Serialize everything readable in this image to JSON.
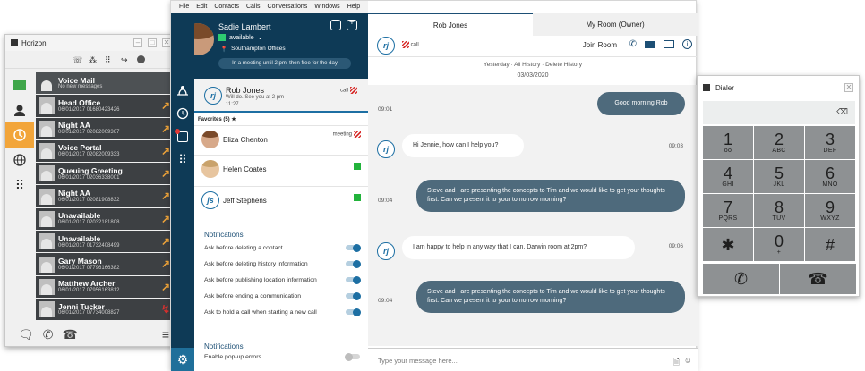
{
  "horizon": {
    "title": "Horizon",
    "entries": [
      {
        "name": "Voice Mail",
        "sub": "No new messages",
        "type": "voicemail"
      },
      {
        "name": "Head Office",
        "sub": "06/01/2017  01680423426",
        "type": "out"
      },
      {
        "name": "Night AA",
        "sub": "06/01/2017  02082009367",
        "type": "out"
      },
      {
        "name": "Voice Portal",
        "sub": "06/01/2017  02082009333",
        "type": "out"
      },
      {
        "name": "Queuing Greeting",
        "sub": "06/01/2017  02036338001",
        "type": "out"
      },
      {
        "name": "Night AA",
        "sub": "06/01/2017  02081908832",
        "type": "out"
      },
      {
        "name": "Unavailable",
        "sub": "06/01/2017  02032181808",
        "type": "out"
      },
      {
        "name": "Unavailable",
        "sub": "06/01/2017  01732408499",
        "type": "out"
      },
      {
        "name": "Gary Mason",
        "sub": "06/01/2017  07796166382",
        "type": "out"
      },
      {
        "name": "Matthew Archer",
        "sub": "06/01/2017  07956163812",
        "type": "out"
      },
      {
        "name": "Jenni Tucker",
        "sub": "06/01/2017  07734008827",
        "type": "missed"
      }
    ]
  },
  "menu": [
    "File",
    "Edit",
    "Contacts",
    "Calls",
    "Conversations",
    "Windows",
    "Help"
  ],
  "profile": {
    "name": "Sadie Lambert",
    "status": "available",
    "location": "Southampton Offices",
    "note": "In a meeting until 2 pm, then free for the day"
  },
  "active_conversation": {
    "initials": "rj",
    "name": "Rob Jones",
    "preview_line1": "Will do. See you at 2 pm",
    "preview_line2": "11:27",
    "tag": "call"
  },
  "favorites_label": "Favorites (5) ★",
  "favorites": [
    {
      "name": "Eliza Chenton",
      "tag": "meeting"
    },
    {
      "name": "Helen Coates",
      "tag": ""
    },
    {
      "name": "Jeff Stephens",
      "tag": "",
      "initials": "js"
    }
  ],
  "notifications": {
    "heading": "Notifications",
    "items": [
      "Ask before deleting a contact",
      "Ask before deleting history information",
      "Ask before publishing location information",
      "Ask before ending a communication",
      "Ask to hold a call when starting a new call"
    ],
    "heading2": "Notifications",
    "popup": "Enable pop-up errors"
  },
  "tabs": [
    "Rob Jones",
    "My Room (Owner)"
  ],
  "chat_header": {
    "initials": "rj",
    "tag": "call",
    "join": "Join Room"
  },
  "history_bar": "Yesterday  ·  All History  ·  Delete History",
  "date": "03/03/2020",
  "messages": [
    {
      "side": "out",
      "time": "09:01",
      "text": "Good morning Rob"
    },
    {
      "side": "in",
      "time": "09:03",
      "text": "Hi Jennie, how can I help you?"
    },
    {
      "side": "out",
      "time": "09:04",
      "text": "Steve and I are presenting the concepts to Tim and we would like to get your thoughts first. Can we present it to your tomorrow morning?"
    },
    {
      "side": "in",
      "time": "09:06",
      "text": "I am happy to help in any way that I can. Darwin room at 2pm?"
    },
    {
      "side": "out",
      "time": "09:04",
      "text": "Steve and I are presenting the concepts to Tim and we would like to get your thoughts first. Can we present it to your tomorrow morning?"
    }
  ],
  "compose_placeholder": "Type your message here...",
  "dialer": {
    "title": "Dialer",
    "keys": [
      {
        "d": "1",
        "l": "oo"
      },
      {
        "d": "2",
        "l": "ABC"
      },
      {
        "d": "3",
        "l": "DEF"
      },
      {
        "d": "4",
        "l": "GHI"
      },
      {
        "d": "5",
        "l": "JKL"
      },
      {
        "d": "6",
        "l": "MNO"
      },
      {
        "d": "7",
        "l": "PQRS"
      },
      {
        "d": "8",
        "l": "TUV"
      },
      {
        "d": "9",
        "l": "WXYZ"
      },
      {
        "d": "✱",
        "l": ""
      },
      {
        "d": "0",
        "l": "+"
      },
      {
        "d": "#",
        "l": ""
      }
    ]
  }
}
